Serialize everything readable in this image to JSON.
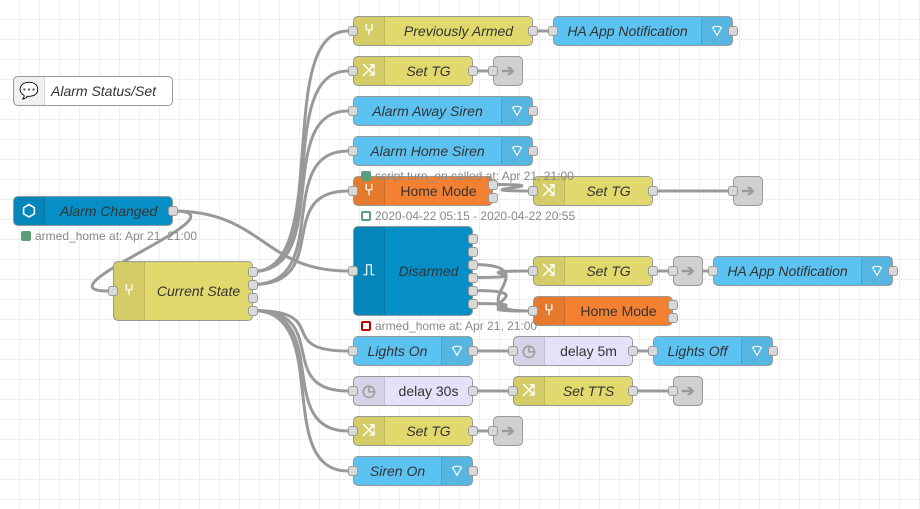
{
  "colors": {
    "switch": "#e2d96e",
    "ha_service": "#5bc2f1",
    "ha_event": "#068fc7",
    "state": "#f48131",
    "delay": "#e6e0f8",
    "link": "#dddddd",
    "comment": "#ffffff",
    "status_green": "#5a9f7a",
    "status_red": "#c00000"
  },
  "nodes": [
    {
      "id": "comment",
      "label": "Alarm Status/Set",
      "type": "comment",
      "icon": "comment-icon"
    },
    {
      "id": "alarm-changed",
      "label": "Alarm Changed",
      "type": "ha_event",
      "icon": "home-assistant-event-icon"
    },
    {
      "id": "current-state",
      "label": "Current State",
      "type": "switch",
      "icon": "switch-icon"
    },
    {
      "id": "previously-armed",
      "label": "Previously Armed",
      "type": "switch",
      "icon": "switch-icon"
    },
    {
      "id": "ha-app-notification-1",
      "label": "HA App Notification",
      "type": "ha_service",
      "icon": "router-icon"
    },
    {
      "id": "set-tg-1",
      "label": "Set TG",
      "type": "switch",
      "icon": "change-icon"
    },
    {
      "id": "link-1",
      "label": "",
      "type": "link",
      "icon": "link-out-icon"
    },
    {
      "id": "alarm-away-siren",
      "label": "Alarm Away Siren",
      "type": "ha_service",
      "icon": "router-icon"
    },
    {
      "id": "alarm-home-siren",
      "label": "Alarm Home Siren",
      "type": "ha_service",
      "icon": "router-icon"
    },
    {
      "id": "home-mode-1",
      "label": "Home Mode",
      "type": "state",
      "icon": "switch-icon"
    },
    {
      "id": "set-tg-2",
      "label": "Set TG",
      "type": "switch",
      "icon": "change-icon"
    },
    {
      "id": "link-2",
      "label": "",
      "type": "link",
      "icon": "link-out-icon"
    },
    {
      "id": "disarmed",
      "label": "Disarmed",
      "type": "ha_event",
      "icon": "trigger-icon"
    },
    {
      "id": "set-tg-3",
      "label": "Set TG",
      "type": "switch",
      "icon": "change-icon"
    },
    {
      "id": "link-3",
      "label": "",
      "type": "link",
      "icon": "link-out-icon"
    },
    {
      "id": "ha-app-notification-2",
      "label": "HA App Notification",
      "type": "ha_service",
      "icon": "router-icon"
    },
    {
      "id": "home-mode-2",
      "label": "Home Mode",
      "type": "state",
      "icon": "switch-icon"
    },
    {
      "id": "lights-on",
      "label": "Lights On",
      "type": "ha_service",
      "icon": "router-icon"
    },
    {
      "id": "delay-5m",
      "label": "delay 5m",
      "type": "delay",
      "icon": "timer-icon"
    },
    {
      "id": "lights-off",
      "label": "Lights Off",
      "type": "ha_service",
      "icon": "router-icon"
    },
    {
      "id": "delay-30s",
      "label": "delay 30s",
      "type": "delay",
      "icon": "timer-icon"
    },
    {
      "id": "set-tts",
      "label": "Set TTS",
      "type": "switch",
      "icon": "change-icon"
    },
    {
      "id": "link-4",
      "label": "",
      "type": "link",
      "icon": "link-out-icon"
    },
    {
      "id": "set-tg-4",
      "label": "Set TG",
      "type": "switch",
      "icon": "change-icon"
    },
    {
      "id": "link-5",
      "label": "",
      "type": "link",
      "icon": "link-out-icon"
    },
    {
      "id": "siren-on",
      "label": "Siren On",
      "type": "ha_service",
      "icon": "router-icon"
    }
  ],
  "statuses": [
    {
      "node": "alarm-changed",
      "text": "armed_home at: Apr 21, 21:00",
      "shape": "dot",
      "color": "green"
    },
    {
      "node": "alarm-home-siren",
      "text": "script.turn_on called at: Apr 21, 21:00",
      "shape": "dot",
      "color": "green"
    },
    {
      "node": "home-mode-1",
      "text": "2020-04-22 05:15 - 2020-04-22 20:55",
      "shape": "ring",
      "color": "green"
    },
    {
      "node": "disarmed",
      "text": "armed_home at: Apr 21, 21:00",
      "shape": "ring",
      "color": "red"
    }
  ]
}
